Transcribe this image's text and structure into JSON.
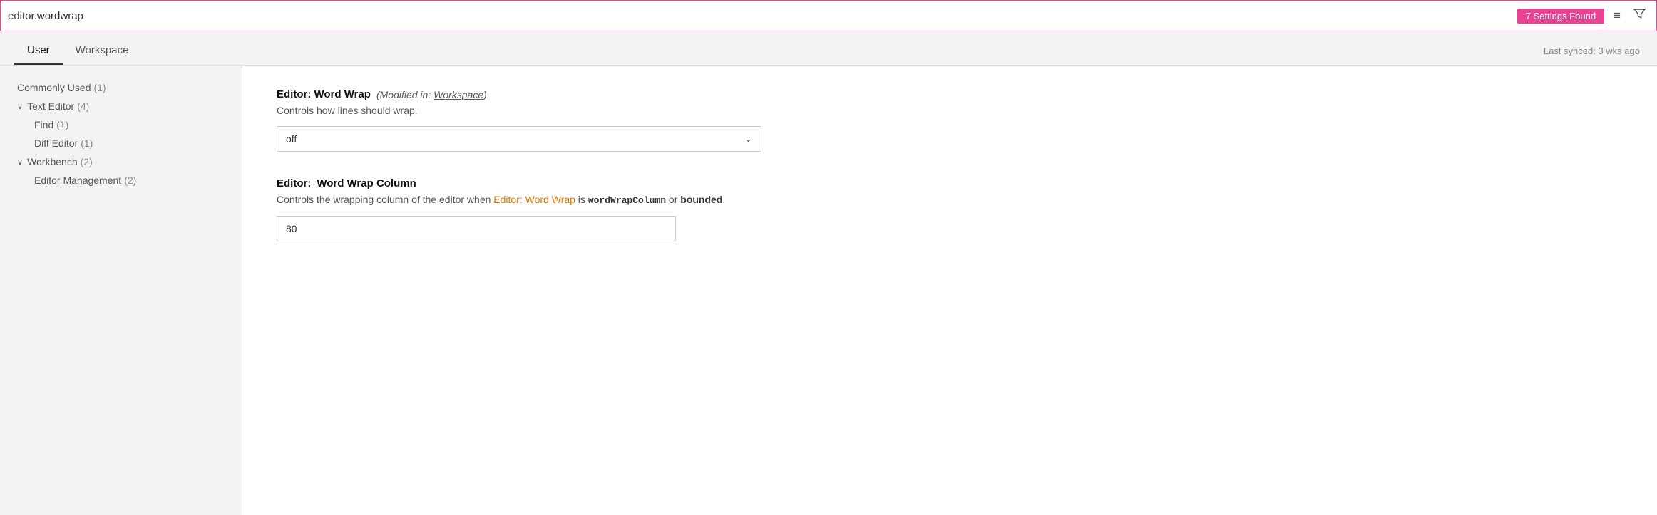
{
  "search": {
    "value": "editor.wordwrap",
    "placeholder": "Search settings",
    "badge": "7 Settings Found"
  },
  "tabs": {
    "user_label": "User",
    "workspace_label": "Workspace",
    "active": "user",
    "sync_text": "Last synced: 3 wks ago"
  },
  "sidebar": {
    "items": [
      {
        "id": "commonly-used",
        "label": "Commonly Used",
        "count": "(1)",
        "indent": false,
        "chevron": false
      },
      {
        "id": "text-editor",
        "label": "Text Editor",
        "count": "(4)",
        "indent": false,
        "chevron": true
      },
      {
        "id": "find",
        "label": "Find",
        "count": "(1)",
        "indent": true,
        "chevron": false
      },
      {
        "id": "diff-editor",
        "label": "Diff Editor",
        "count": "(1)",
        "indent": true,
        "chevron": false
      },
      {
        "id": "workbench",
        "label": "Workbench",
        "count": "(2)",
        "indent": false,
        "chevron": true
      },
      {
        "id": "editor-management",
        "label": "Editor Management",
        "count": "(2)",
        "indent": true,
        "chevron": false
      }
    ]
  },
  "settings": [
    {
      "id": "word-wrap",
      "title_prefix": "Editor: ",
      "title_bold": "Word Wrap",
      "modified_text": "(Modified in: ",
      "modified_link": "Workspace",
      "modified_close": ")",
      "description": "Controls how lines should wrap.",
      "control_type": "dropdown",
      "dropdown_value": "off",
      "dropdown_arrow": "⌄"
    },
    {
      "id": "word-wrap-column",
      "title_prefix": "Editor: ",
      "title_bold": "Word Wrap Column",
      "description_before": "Controls the wrapping column of the editor when ",
      "description_link": "Editor: Word Wrap",
      "description_mid": " is ",
      "description_code1": "wordWrapColumn",
      "description_or": " or ",
      "description_bold": "bounded",
      "description_after": ".",
      "control_type": "number",
      "number_value": "80"
    }
  ],
  "icons": {
    "sort": "≡",
    "filter": "⊻",
    "chevron_down": "∨"
  }
}
